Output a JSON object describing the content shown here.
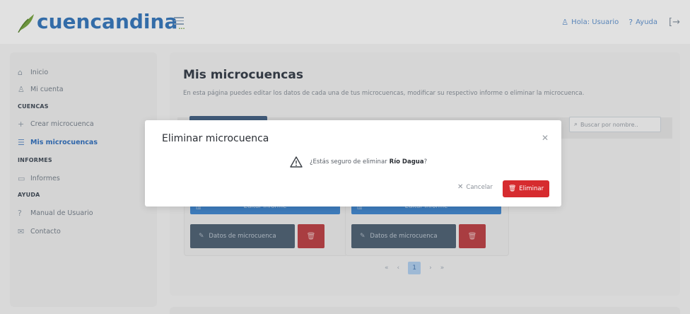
{
  "header": {
    "brand": "cuencandina",
    "brand_suffix": "...",
    "greeting": "Hola: Usuario",
    "help": "Ayuda",
    "colors": {
      "brand_blue": "#2e6fb3",
      "leaf_green": "#6f9c3a"
    }
  },
  "sidebar": {
    "inicio": "Inicio",
    "mi_cuenta": "Mi cuenta",
    "section_cuencas": "CUENCAS",
    "crear": "Crear microcuenca",
    "mis": "Mis microcuencas",
    "section_informes": "INFORMES",
    "informes": "Informes",
    "section_ayuda": "AYUDA",
    "manual": "Manual de Usuario",
    "contacto": "Contacto"
  },
  "main": {
    "title": "Mis microcuencas",
    "description": "En esta página puedes editar los datos de cada una de tus microcuencas, modificar su respectivo informe o eliminar la microcuenca.",
    "search_placeholder": "Buscar por nombre..",
    "cards": [
      {
        "edit_report": "Editar informe",
        "data_label": "Datos de microcuenca"
      },
      {
        "edit_report": "Editar informe",
        "data_label": "Datos de microcuenca"
      }
    ],
    "pager": {
      "first": "«",
      "prev": "‹",
      "current": "1",
      "next": "›",
      "last": "»"
    }
  },
  "modal": {
    "title": "Eliminar microcuenca",
    "message": "¿Estás seguro de eliminar",
    "target": "Río Dagua",
    "question_end": "?",
    "cancel": "Cancelar",
    "confirm": "Eliminar",
    "colors": {
      "danger": "#d62b2f"
    }
  }
}
